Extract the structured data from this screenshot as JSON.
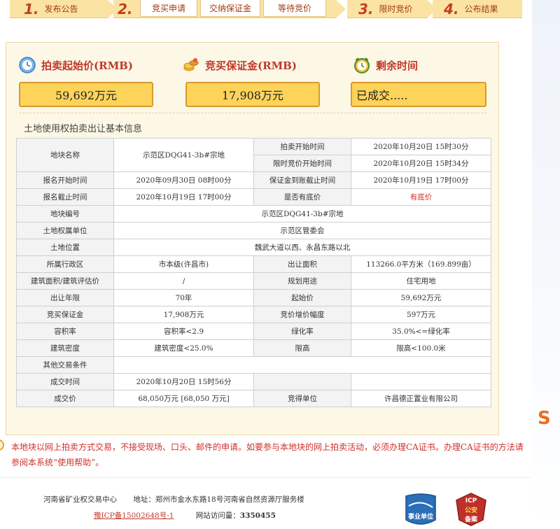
{
  "steps": [
    {
      "num": "1.",
      "label": "发布公告"
    },
    {
      "num": "2.",
      "label": ""
    },
    {
      "num": "3.",
      "label": "限时竞价"
    },
    {
      "num": "4.",
      "label": "公布结果"
    }
  ],
  "substeps": [
    "竞买申请",
    "交纳保证金",
    "等待竞价"
  ],
  "summary": {
    "start_price_label": "拍卖起始价(RMB)",
    "start_price_value": "59,692万元",
    "deposit_label": "竞买保证金(RMB)",
    "deposit_value": "17,908万元",
    "remaining_label": "剩余时间",
    "remaining_value": "已成交....."
  },
  "section_title": "土地使用权拍卖出让基本信息",
  "table": {
    "r1": {
      "l1": "地块名称",
      "v1": "示范区DQG41-3b#宗地",
      "l2": "拍卖开始时间",
      "v2": "2020年10月20日 15时30分"
    },
    "r2": {
      "l2": "限时竞价开始时间",
      "v2": "2020年10月20日 15时34分"
    },
    "r3": {
      "l1": "报名开始时间",
      "v1": "2020年09月30日 08时00分",
      "l2": "保证金到账截止时间",
      "v2": "2020年10月19日 17时00分"
    },
    "r4": {
      "l1": "报名截止时间",
      "v1": "2020年10月19日 17时00分",
      "l2": "是否有底价",
      "v2": "有底价"
    },
    "r5": {
      "l1": "地块编号",
      "v1": "示范区DQG41-3b#宗地"
    },
    "r6": {
      "l1": "土地权属单位",
      "v1": "示范区管委会"
    },
    "r7": {
      "l1": "土地位置",
      "v1": "魏武大道以西、永昌东路以北"
    },
    "r8": {
      "l1": "所属行政区",
      "v1": "市本级(许昌市)",
      "l2": "出让面积",
      "v2": "113266.0平方米（169.899亩）"
    },
    "r9": {
      "l1": "建筑面积/建筑评估价",
      "v1": "/",
      "l2": "规划用途",
      "v2": "住宅用地"
    },
    "r10": {
      "l1": "出让年限",
      "v1": "70年",
      "l2": "起始价",
      "v2": "59,692万元"
    },
    "r11": {
      "l1": "竞买保证金",
      "v1": "17,908万元",
      "l2": "竞价增价幅度",
      "v2": "597万元"
    },
    "r12": {
      "l1": "容积率",
      "v1": "容积率<2.9",
      "l2": "绿化率",
      "v2": "35.0%<=绿化率"
    },
    "r13": {
      "l1": "建筑密度",
      "v1": "建筑密度<25.0%",
      "l2": "限高",
      "v2": "限高<100.0米"
    },
    "r14": {
      "l1": "其他交易条件",
      "v1": ""
    },
    "r15": {
      "l1": "成交时间",
      "v1": "2020年10月20日 15时56分",
      "l2": "",
      "v2": ""
    },
    "r16": {
      "l1": "成交价",
      "v1": "68,050万元 [68,050 万元]",
      "l2": "竞得单位",
      "v2": "许昌德正置业有限公司"
    }
  },
  "notice": "本地块以网上拍卖方式交易，不接受现场、口头、邮件的申请。如要参与本地块的网上拍卖活动，必须办理CA证书。办理CA证书的方法请参阅本系统“使用帮助”。",
  "footer": {
    "org": "河南省矿业权交易中心",
    "address": "地址：郑州市金水东路18号河南省自然资源厅服务楼",
    "icp": "豫ICP备15002648号-1",
    "visits_label": "网站访问量：",
    "visits_value": "3350455",
    "badge1": "事业单位",
    "badge2_top": "ICP",
    "badge2_mid": "公安",
    "badge2_bot": "备案"
  },
  "colors": {
    "accent": "#c0392b",
    "highlight": "#fdd35a",
    "panel": "#fdf7e6"
  }
}
